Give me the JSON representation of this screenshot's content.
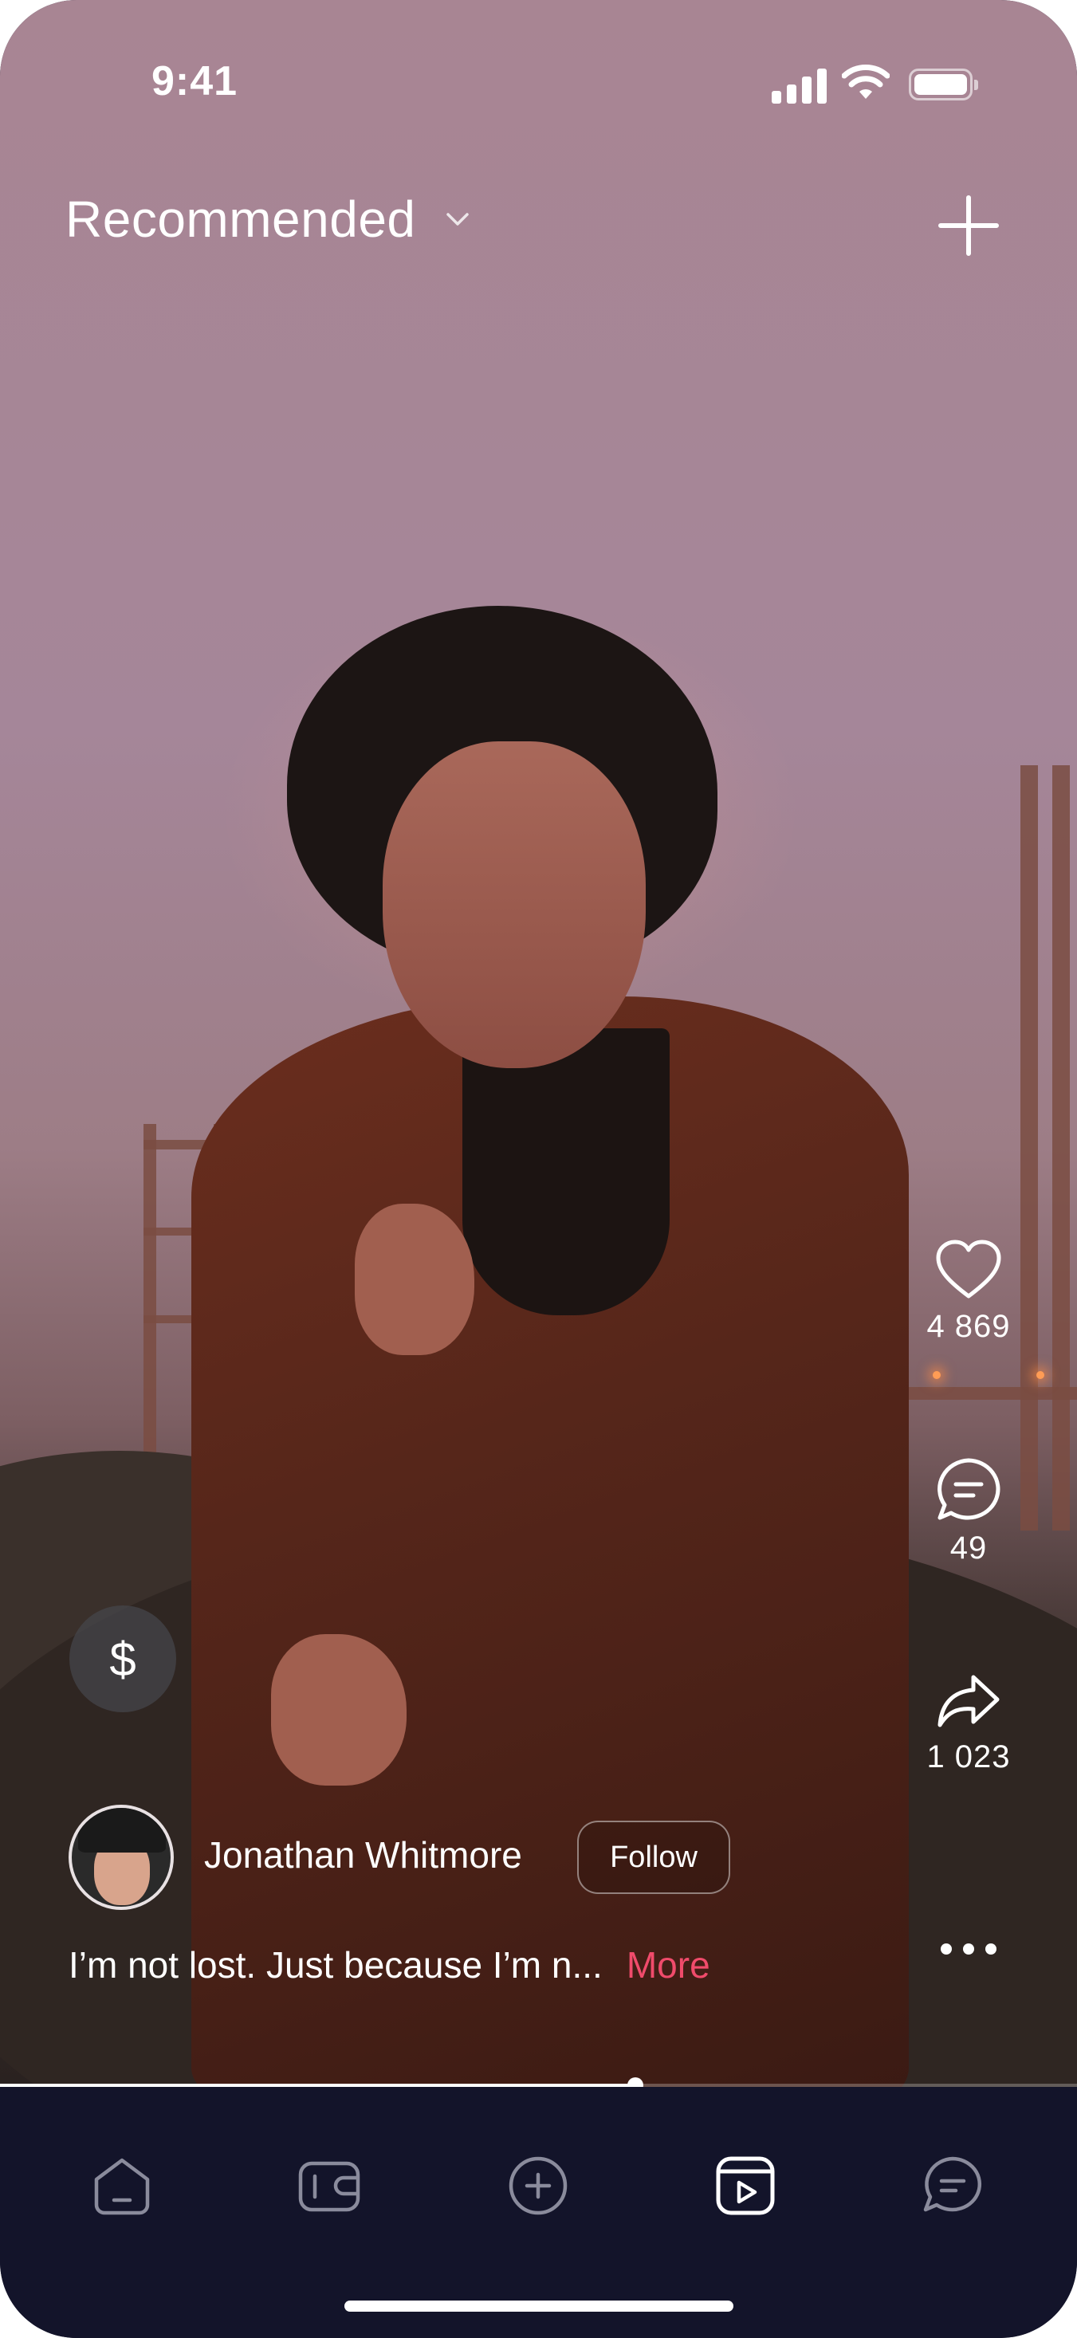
{
  "status_bar": {
    "time": "9:41"
  },
  "header": {
    "feed_label": "Recommended"
  },
  "actions": {
    "likes": "4 869",
    "comments": "49",
    "shares": "1 023"
  },
  "tip": {
    "symbol": "$"
  },
  "post": {
    "author": "Jonathan Whitmore",
    "follow_label": "Follow",
    "caption": "I’m not lost. Just because I’m n...",
    "more_label": "More",
    "progress": 0.59
  },
  "tabs": [
    {
      "icon": "home-icon",
      "active": false
    },
    {
      "icon": "wallet-icon",
      "active": false
    },
    {
      "icon": "plus-circle-icon",
      "active": false
    },
    {
      "icon": "video-play-icon",
      "active": true
    },
    {
      "icon": "chat-icon",
      "active": false
    }
  ],
  "colors": {
    "accent": "#f04b6b",
    "tabbar": "#13142a",
    "tab_inactive": "#8a8b9c",
    "tab_active": "#ffffff"
  }
}
